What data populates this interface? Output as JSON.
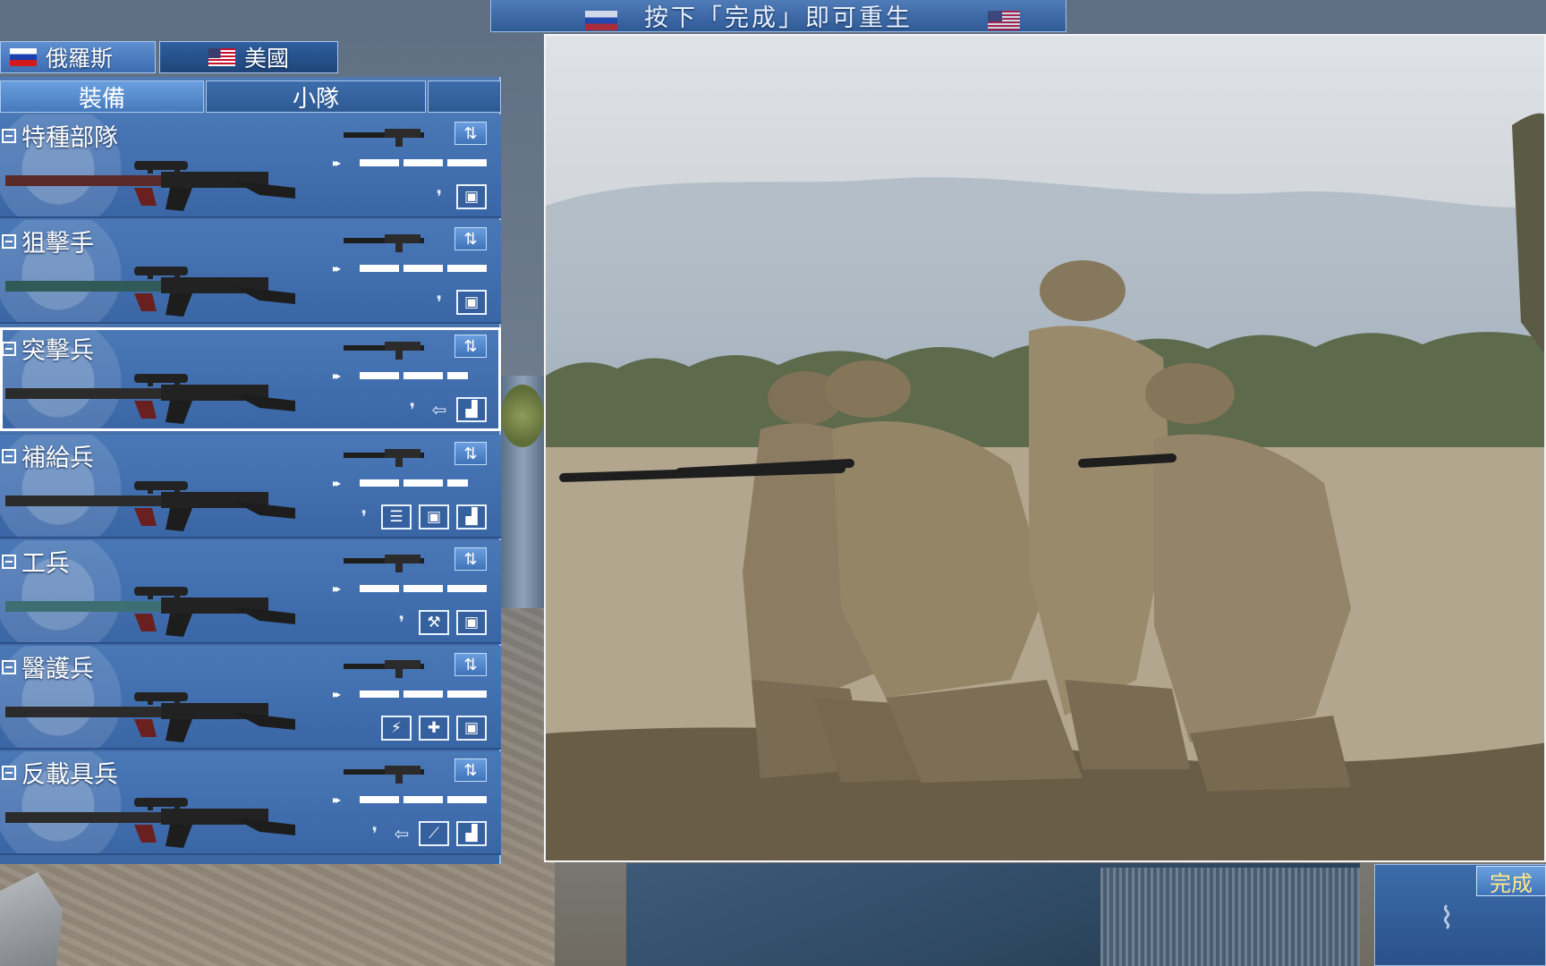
{
  "banner": {
    "message": "按下「完成」即可重生"
  },
  "factions": [
    {
      "label": "俄羅斯",
      "flag": "russia-flag"
    },
    {
      "label": "美國",
      "flag": "usa-flag"
    }
  ],
  "tabs": {
    "equipment": "裝備",
    "squad": "小隊"
  },
  "kits": [
    {
      "label": "特種部隊",
      "ammo": 1.0,
      "slots": [
        "grenade-icon",
        "c4-icon"
      ]
    },
    {
      "label": "狙擊手",
      "ammo": 1.0,
      "slots": [
        "grenade-icon",
        "claymore-icon"
      ]
    },
    {
      "label": "突擊兵",
      "ammo": 0.85,
      "selected": true,
      "slots": [
        "grenade-icon",
        "smoke-icon",
        "flashbang-icon"
      ]
    },
    {
      "label": "補給兵",
      "ammo": 0.85,
      "slots": [
        "grenade-icon",
        "ammo-box-icon",
        "c4-icon",
        "flashbang-icon"
      ]
    },
    {
      "label": "工兵",
      "ammo": 1.0,
      "slots": [
        "grenade-icon",
        "wrench-icon",
        "c4-icon"
      ]
    },
    {
      "label": "醫護兵",
      "ammo": 1.0,
      "slots": [
        "defibrillator-icon",
        "medkit-icon",
        "c4-icon"
      ]
    },
    {
      "label": "反載具兵",
      "ammo": 1.0,
      "slots": [
        "grenade-icon",
        "smoke-icon",
        "rocket-icon",
        "flashbang-icon"
      ]
    }
  ],
  "done_button": {
    "label": "完成"
  },
  "colors": {
    "panel_blue": "#4a78b7",
    "done_text": "#ffe88a"
  }
}
